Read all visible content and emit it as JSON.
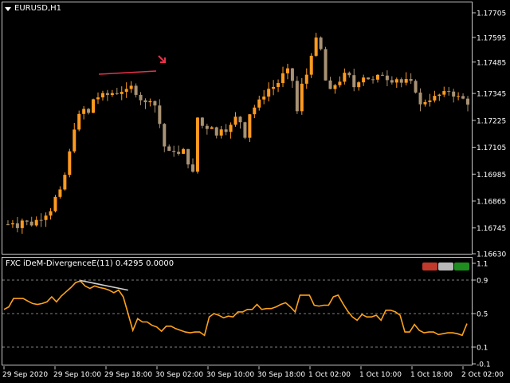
{
  "chart": {
    "title": "EURUSD,H1",
    "price_axis": [
      "1.17705",
      "1.17595",
      "1.17485",
      "1.17345",
      "1.17225",
      "1.17105",
      "1.16985",
      "1.16865",
      "1.16745",
      "1.16630"
    ],
    "price_range": [
      1.1663,
      1.17765
    ],
    "time_axis": [
      "29 Sep 2020",
      "29 Sep 10:00",
      "29 Sep 18:00",
      "30 Sep 02:00",
      "30 Sep 10:00",
      "30 Sep 18:00",
      "1 Oct 02:00",
      "1 Oct 10:00",
      "1 Oct 18:00",
      "2 Oct 02:00"
    ],
    "colors": {
      "bull": "#ff9a1f",
      "bear": "#a89274",
      "trendline": "#e8324a",
      "arrow": "#e8324a",
      "indicator": "#ffa21a",
      "ind_trendline": "#d0d0d0",
      "grid": "#808080",
      "border": "#c8c8c8"
    }
  },
  "indicator": {
    "title": "FXC iDeM-DivergenceE(11) 0.4295 0.0000",
    "levels_axis": [
      "1.1",
      "0.9",
      "0.5",
      "0.1",
      "-0.1"
    ],
    "level_lines": [
      0.9,
      0.5,
      0.1
    ],
    "range": [
      -0.1,
      1.1
    ]
  },
  "chart_data": {
    "type": "line",
    "x": [
      1,
      2,
      3,
      4,
      5,
      6,
      7,
      8,
      9,
      10,
      11,
      12,
      13,
      14,
      15,
      16,
      17,
      18,
      19,
      20,
      21,
      22,
      23,
      24,
      25,
      26,
      27,
      28,
      29,
      30,
      31,
      32,
      33,
      34,
      35,
      36,
      37,
      38,
      39,
      40,
      41,
      42,
      43,
      44,
      45,
      46,
      47,
      48,
      49,
      50,
      51,
      52,
      53,
      54,
      55,
      56,
      57,
      58,
      59,
      60,
      61,
      62,
      63,
      64,
      65,
      66,
      67,
      68,
      69,
      70,
      71,
      72,
      73,
      74,
      75,
      76,
      77,
      78,
      79,
      80,
      81,
      82,
      83,
      84,
      85,
      86,
      87,
      88,
      89,
      90,
      91,
      92,
      93,
      94,
      95,
      96,
      97,
      98
    ],
    "series": [
      {
        "values": [
          0.55,
          0.58,
          0.68,
          0.68,
          0.68,
          0.65,
          0.62,
          0.61,
          0.62,
          0.64,
          0.7,
          0.64,
          0.71,
          0.76,
          0.81,
          0.87,
          0.89,
          0.83,
          0.8,
          0.83,
          0.81,
          0.8,
          0.78,
          0.75,
          0.78,
          0.7,
          0.5,
          0.3,
          0.44,
          0.4,
          0.4,
          0.36,
          0.34,
          0.29,
          0.35,
          0.35,
          0.32,
          0.3,
          0.28,
          0.27,
          0.28,
          0.28,
          0.24,
          0.46,
          0.5,
          0.48,
          0.45,
          0.47,
          0.46,
          0.52,
          0.52,
          0.55,
          0.55,
          0.61,
          0.55,
          0.56,
          0.56,
          0.58,
          0.61,
          0.63,
          0.58,
          0.52,
          0.72,
          0.72,
          0.72,
          0.6,
          0.59,
          0.6,
          0.6,
          0.7,
          0.72,
          0.62,
          0.53,
          0.46,
          0.42,
          0.49,
          0.46,
          0.46,
          0.48,
          0.42,
          0.54,
          0.54,
          0.52,
          0.48,
          0.28,
          0.28,
          0.37,
          0.3,
          0.27,
          0.28,
          0.28,
          0.25,
          0.26,
          0.27,
          0.27,
          0.26,
          0.24,
          0.38
        ]
      }
    ],
    "ylim": [
      -0.1,
      1.1
    ]
  }
}
